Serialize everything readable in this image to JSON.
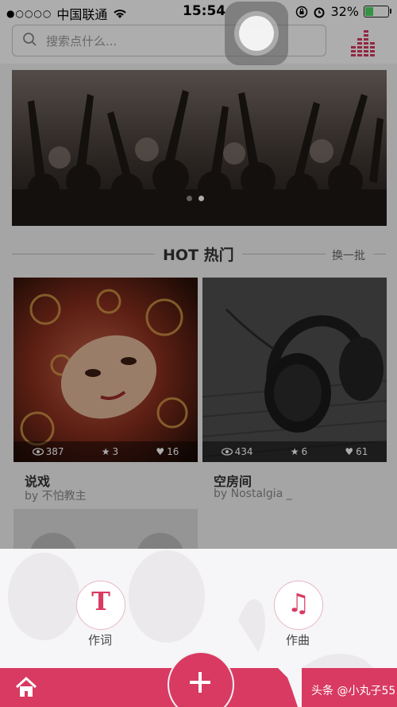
{
  "status_bar": {
    "signal_dots": "●○○○○",
    "carrier": "中国联通",
    "time": "15:54",
    "battery_percent": "32%",
    "battery_level": 0.32
  },
  "search": {
    "placeholder": "搜索点什么..."
  },
  "banner": {
    "slides": 2,
    "active": 1
  },
  "hot_section": {
    "title": "HOT 热门",
    "refresh_label": "换一批"
  },
  "cards": [
    {
      "title": "说戏",
      "author": "by 不怕教主",
      "views": "387",
      "stars": "3",
      "likes": "16"
    },
    {
      "title": "空房间",
      "author": "by Nostalgia _",
      "views": "434",
      "stars": "6",
      "likes": "61"
    }
  ],
  "actions": [
    {
      "label": "作词",
      "icon": "T"
    },
    {
      "label": "作曲",
      "icon": "♫"
    }
  ],
  "watermark": "头条 @小丸子55",
  "colors": {
    "accent": "#d83a62",
    "battery": "#4cd964"
  }
}
